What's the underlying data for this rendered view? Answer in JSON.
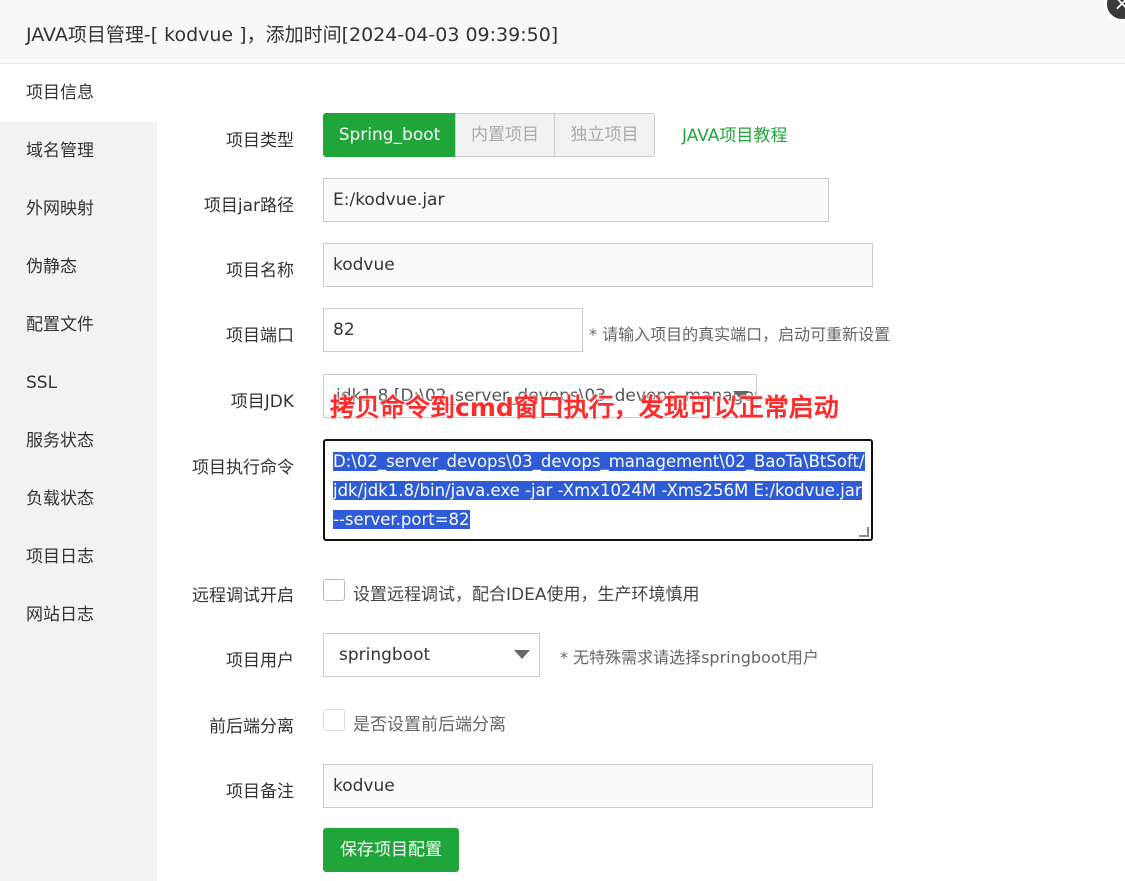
{
  "window": {
    "title": "JAVA项目管理-[ kodvue ]，添加时间[2024-04-03 09:39:50]",
    "close_glyph": "×"
  },
  "sidebar": {
    "items": [
      {
        "label": "项目信息"
      },
      {
        "label": "域名管理"
      },
      {
        "label": "外网映射"
      },
      {
        "label": "伪静态"
      },
      {
        "label": "配置文件"
      },
      {
        "label": "SSL"
      },
      {
        "label": "服务状态"
      },
      {
        "label": "负载状态"
      },
      {
        "label": "项目日志"
      },
      {
        "label": "网站日志"
      }
    ],
    "active_index": 0
  },
  "form": {
    "project_type": {
      "label": "项目类型",
      "options": [
        "Spring_boot",
        "内置项目",
        "独立项目"
      ],
      "selected": "Spring_boot",
      "tutorial_link": "JAVA项目教程"
    },
    "jar_path": {
      "label": "项目jar路径",
      "value": "E:/kodvue.jar"
    },
    "name": {
      "label": "项目名称",
      "value": "kodvue"
    },
    "port": {
      "label": "项目端口",
      "value": "82",
      "hint": "* 请输入项目的真实端口，启动可重新设置"
    },
    "jdk": {
      "label": "项目JDK",
      "value": "jdk1.8 [D:\\02_server_devops\\03_devops_management"
    },
    "command": {
      "label": "项目执行命令",
      "lines": [
        "D:\\02_server_devops\\03_devops_management\\02_BaoTa\\BtSoft/",
        "jdk/jdk1.8/bin/java.exe -jar -Xmx1024M -Xms256M E:/kodvue.jar",
        "--server.port=82"
      ]
    },
    "remote_debug": {
      "label": "远程调试开启",
      "text": "设置远程调试，配合IDEA使用，生产环境慎用",
      "checked": "false"
    },
    "user": {
      "label": "项目用户",
      "value": "springboot",
      "hint": "* 无特殊需求请选择springboot用户"
    },
    "separation": {
      "label": "前后端分离",
      "text": "是否设置前后端分离",
      "checked": "false"
    },
    "remark": {
      "label": "项目备注",
      "value": "kodvue"
    },
    "save_label": "保存项目配置"
  },
  "annotation": {
    "text": "拷贝命令到cmd窗口执行，发现可以正常启动",
    "color": "#ff2a2a"
  },
  "colors": {
    "accent": "#20a53a",
    "selection": "#2e5bd6"
  }
}
